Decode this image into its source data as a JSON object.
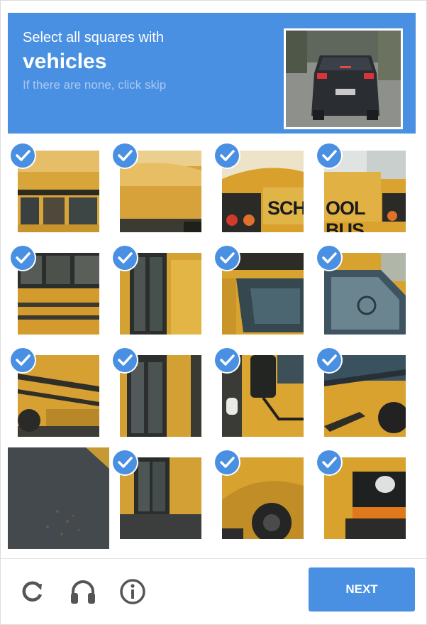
{
  "header": {
    "line1": "Select all squares with",
    "keyword": "vehicles",
    "line3": "If there are none, click skip"
  },
  "tiles": [
    {
      "selected": true
    },
    {
      "selected": true
    },
    {
      "selected": true
    },
    {
      "selected": true
    },
    {
      "selected": true
    },
    {
      "selected": true
    },
    {
      "selected": true
    },
    {
      "selected": true
    },
    {
      "selected": true
    },
    {
      "selected": true
    },
    {
      "selected": true
    },
    {
      "selected": true
    },
    {
      "selected": false
    },
    {
      "selected": true
    },
    {
      "selected": true
    },
    {
      "selected": true
    }
  ],
  "tile_images": {
    "sign_left": "SCHC",
    "sign_right": "OOL BUS"
  },
  "footer": {
    "next_label": "NEXT",
    "icons": [
      "reload-icon",
      "headphones-icon",
      "info-icon"
    ]
  },
  "colors": {
    "accent": "#4a90e2",
    "bus_yellow": "#d9a42b"
  }
}
